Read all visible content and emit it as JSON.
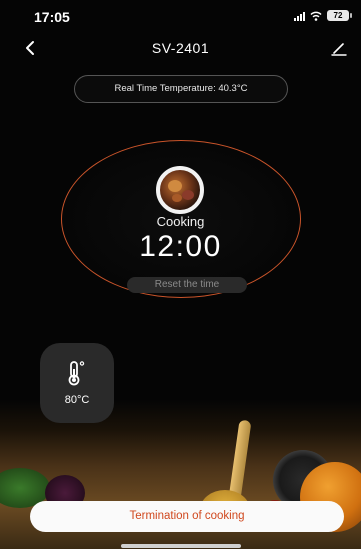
{
  "status_bar": {
    "time": "17:05",
    "battery": "72",
    "icons": [
      "signal-icon",
      "wifi-icon",
      "battery-icon"
    ]
  },
  "nav": {
    "title": "SV-2401",
    "back_icon": "chevron-left-icon",
    "edit_icon": "pencil-icon"
  },
  "temperature_pill": {
    "text": "Real Time Temperature: 40.3°C"
  },
  "cooking": {
    "status": "Cooking",
    "timer": "12:00",
    "reset_label": "Reset the time"
  },
  "temperature_card": {
    "icon": "thermometer-icon",
    "value": "80°C"
  },
  "bottom": {
    "terminate_label": "Termination of cooking"
  },
  "colors": {
    "accent": "#d0481e",
    "ring": "#c9542a",
    "background": "#050505"
  }
}
